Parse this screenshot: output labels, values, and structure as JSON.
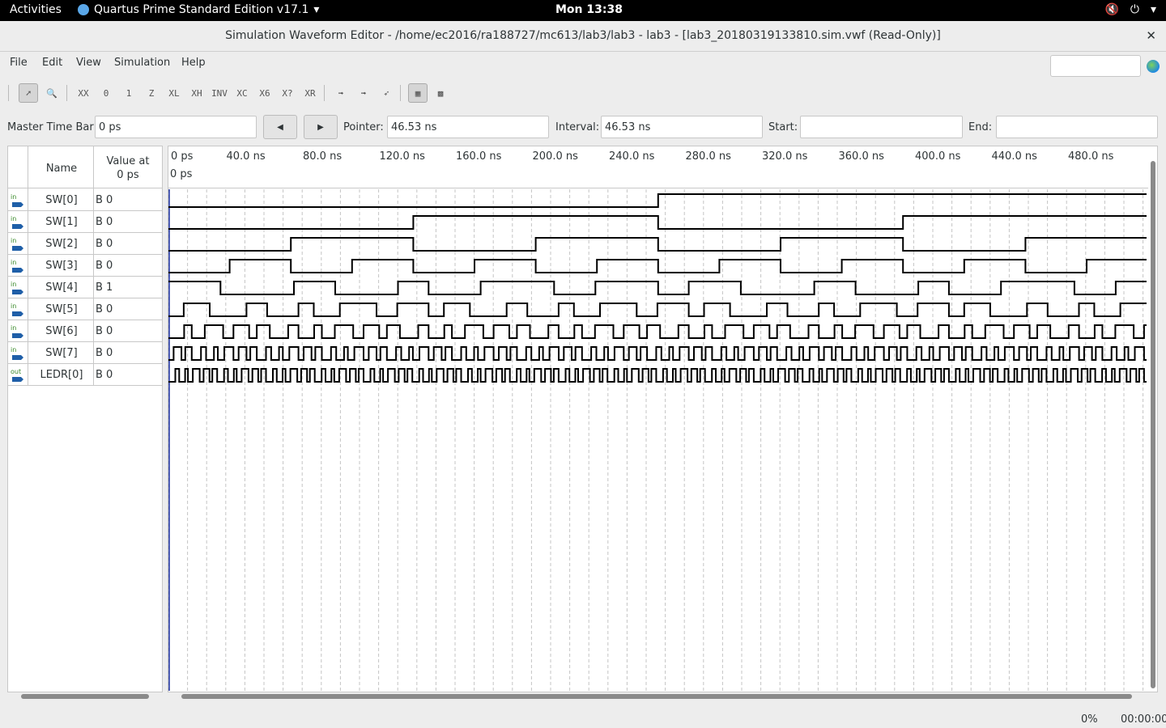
{
  "topbar": {
    "activities": "Activities",
    "app": "Quartus Prime Standard Edition v17.1",
    "clock": "Mon 13:38"
  },
  "window": {
    "title": "Simulation Waveform Editor - /home/ec2016/ra188727/mc613/lab3/lab3 - lab3 - [lab3_20180319133810.sim.vwf (Read-Only)]"
  },
  "menu": [
    "File",
    "Edit",
    "View",
    "Simulation",
    "Help"
  ],
  "timebar": {
    "master_label": "Master Time Bar:",
    "master_value": "0 ps",
    "pointer_label": "Pointer:",
    "pointer_value": "46.53 ns",
    "interval_label": "Interval:",
    "interval_value": "46.53 ns",
    "start_label": "Start:",
    "start_value": "",
    "end_label": "End:",
    "end_value": ""
  },
  "table": {
    "name_header": "Name",
    "value_header_1": "Value at",
    "value_header_2": "0 ps"
  },
  "ruler": {
    "zero_label": "0 ps",
    "ticks": [
      "0 ps",
      "40.0 ns",
      "80.0 ns",
      "120.0 ns",
      "160.0 ns",
      "200.0 ns",
      "240.0 ns",
      "280.0 ns",
      "320.0 ns",
      "360.0 ns",
      "400.0 ns",
      "440.0 ns",
      "480.0 ns"
    ]
  },
  "signals": [
    {
      "dir": "in",
      "name": "SW[0]",
      "value": "B 0",
      "period_ns": 512
    },
    {
      "dir": "in",
      "name": "SW[1]",
      "value": "B 0",
      "period_ns": 256
    },
    {
      "dir": "in",
      "name": "SW[2]",
      "value": "B 0",
      "period_ns": 128
    },
    {
      "dir": "in",
      "name": "SW[3]",
      "value": "B 0",
      "period_ns": 64
    },
    {
      "dir": "in",
      "name": "SW[4]",
      "value": "B 1",
      "period_ns": 32
    },
    {
      "dir": "in",
      "name": "SW[5]",
      "value": "B 0",
      "period_ns": 16
    },
    {
      "dir": "in",
      "name": "SW[6]",
      "value": "B 0",
      "period_ns": 8
    },
    {
      "dir": "in",
      "name": "SW[7]",
      "value": "B 0",
      "period_ns": 4
    },
    {
      "dir": "out",
      "name": "LEDR[0]",
      "value": "B 0",
      "period_ns": 3
    }
  ],
  "status": {
    "progress": "0%",
    "elapsed": "00:00:00"
  }
}
